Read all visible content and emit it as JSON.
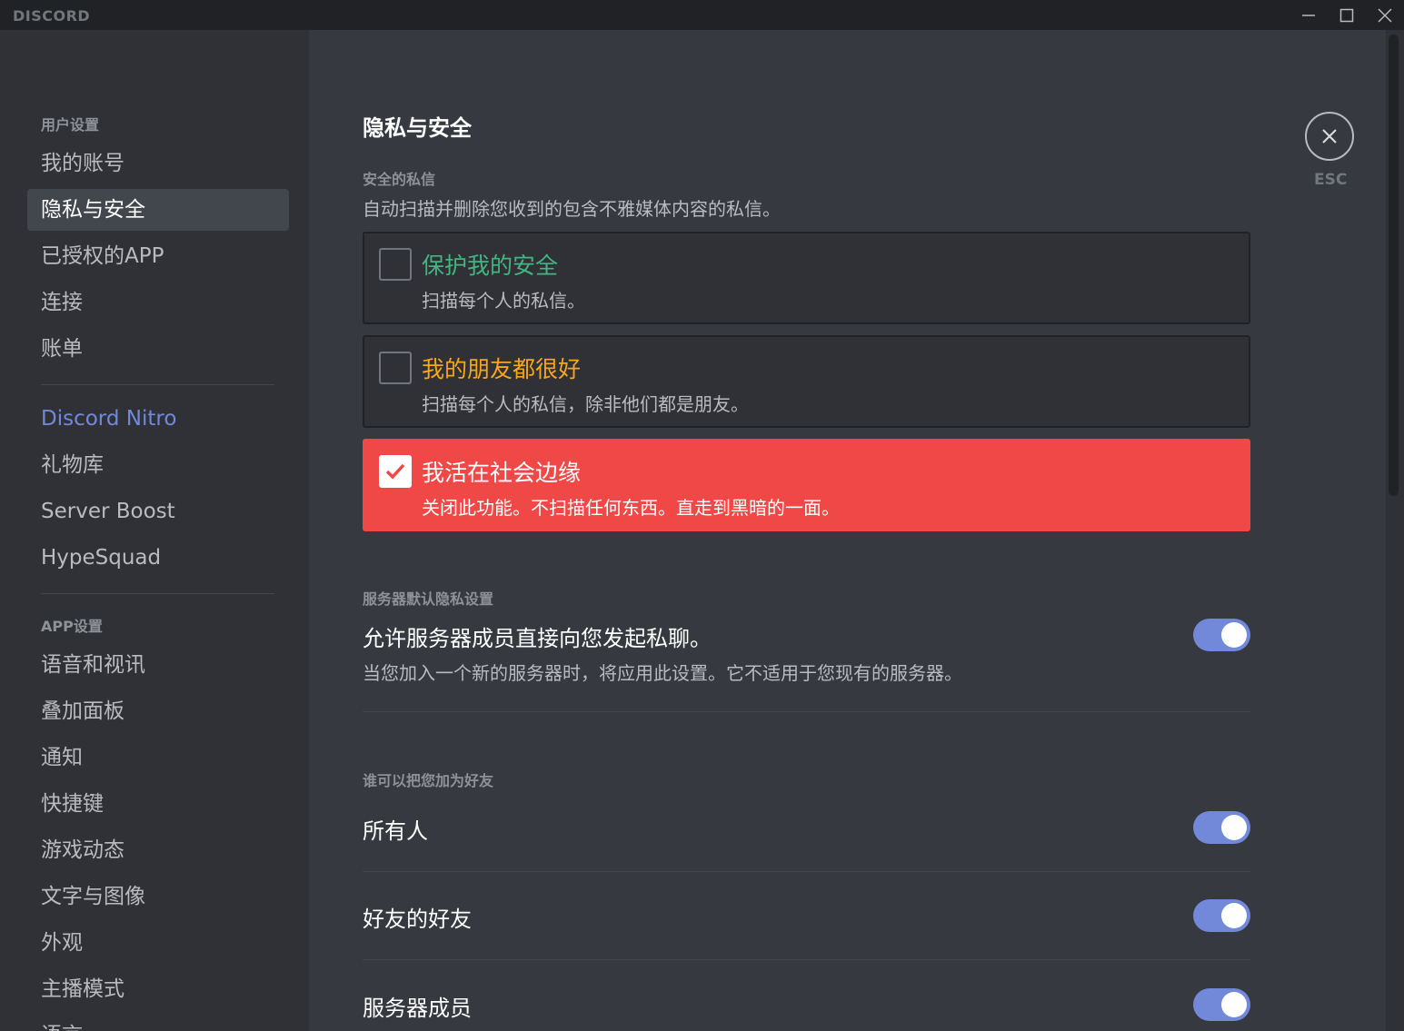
{
  "app": {
    "title": "DISCORD"
  },
  "window_controls": [
    "minimize-icon",
    "maximize-icon",
    "close-icon"
  ],
  "colors": {
    "accent": "#7289da",
    "danger": "#f04747",
    "green": "#43b581",
    "yellow": "#faa61a"
  },
  "sidebar": {
    "user_settings_header": "用户设置",
    "user_items": [
      {
        "label": "我的账号"
      },
      {
        "label": "隐私与安全",
        "selected": true
      },
      {
        "label": "已授权的APP"
      },
      {
        "label": "连接"
      },
      {
        "label": "账单"
      }
    ],
    "nitro_items": [
      {
        "label": "Discord Nitro"
      },
      {
        "label": "礼物库"
      },
      {
        "label": "Server Boost"
      },
      {
        "label": "HypeSquad"
      }
    ],
    "app_settings_header": "APP设置",
    "app_items": [
      {
        "label": "语音和视讯"
      },
      {
        "label": "叠加面板"
      },
      {
        "label": "通知"
      },
      {
        "label": "快捷键"
      },
      {
        "label": "游戏动态"
      },
      {
        "label": "文字与图像"
      },
      {
        "label": "外观"
      },
      {
        "label": "主播模式"
      },
      {
        "label": "语言"
      }
    ]
  },
  "main": {
    "title": "隐私与安全",
    "safe_dm": {
      "label": "安全的私信",
      "description": "自动扫描并删除您收到的包含不雅媒体内容的私信。",
      "options": [
        {
          "title": "保护我的安全",
          "desc": "扫描每个人的私信。",
          "checked": false
        },
        {
          "title": "我的朋友都很好",
          "desc": "扫描每个人的私信，除非他们都是朋友。",
          "checked": false
        },
        {
          "title": "我活在社会边缘",
          "desc": "关闭此功能。不扫描任何东西。直走到黑暗的一面。",
          "checked": true
        }
      ]
    },
    "server_privacy": {
      "label": "服务器默认隐私设置",
      "toggle_title": "允许服务器成员直接向您发起私聊。",
      "toggle_desc": "当您加入一个新的服务器时，将应用此设置。它不适用于您现有的服务器。",
      "toggle_on": true
    },
    "friend_requests": {
      "label": "谁可以把您加为好友",
      "items": [
        {
          "title": "所有人",
          "on": true
        },
        {
          "title": "好友的好友",
          "on": true
        },
        {
          "title": "服务器成员",
          "on": true
        }
      ]
    },
    "close": {
      "label": "ESC"
    }
  }
}
